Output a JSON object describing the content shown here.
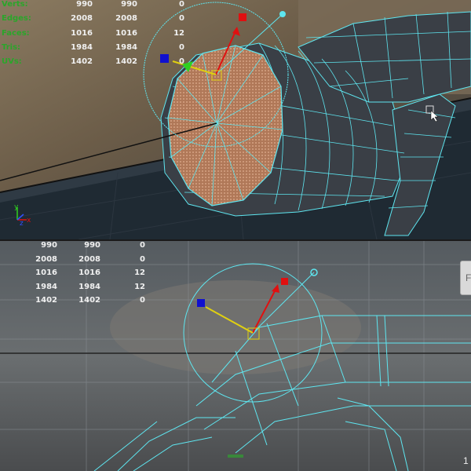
{
  "top_hud": {
    "rows": [
      {
        "label": "Verts:",
        "v1": "990",
        "v2": "990",
        "v3": "0"
      },
      {
        "label": "Edges:",
        "v1": "2008",
        "v2": "2008",
        "v3": "0"
      },
      {
        "label": "Faces:",
        "v1": "1016",
        "v2": "1016",
        "v3": "12"
      },
      {
        "label": "Tris:",
        "v1": "1984",
        "v2": "1984",
        "v3": "0"
      },
      {
        "label": "UVs:",
        "v1": "1402",
        "v2": "1402",
        "v3": "0"
      }
    ]
  },
  "bottom_hud": {
    "rows": [
      {
        "v1": "990",
        "v2": "990",
        "v3": "0"
      },
      {
        "v1": "2008",
        "v2": "2008",
        "v3": "0"
      },
      {
        "v1": "1016",
        "v2": "1016",
        "v3": "12"
      },
      {
        "v1": "1984",
        "v2": "1984",
        "v3": "12"
      },
      {
        "v1": "1402",
        "v2": "1402",
        "v3": "0"
      }
    ]
  },
  "axis_indicator": {
    "x": "x",
    "y": "y",
    "z": "z"
  },
  "side_button_label": "F",
  "corner_label": "1",
  "colors": {
    "wire": "#5ee6f0",
    "hud_label": "#2aa62a",
    "gizmo_y": "#e01010",
    "gizmo_x": "#1010d0",
    "gizmo_z": "#e0d010",
    "selected_face": "#c08060"
  },
  "icons": [
    "move-gizmo-icon",
    "axis-indicator-icon",
    "cursor-icon"
  ]
}
